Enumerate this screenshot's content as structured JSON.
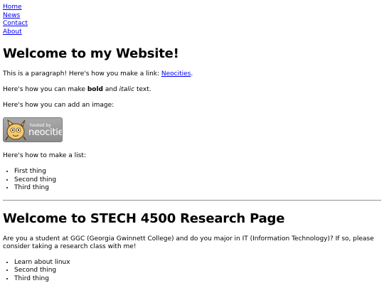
{
  "nav": {
    "items": [
      "Home",
      "News",
      "Contact",
      "About"
    ]
  },
  "section1": {
    "heading": "Welcome to my Website!",
    "para_link_prefix": "This is a paragraph! Here's how you make a link: ",
    "link_text": "Neocities",
    "para_link_suffix": ".",
    "bold_prefix": "Here's how you can make ",
    "bold_word": "bold",
    "bold_middle": " and ",
    "italic_word": "italic",
    "bold_suffix": " text.",
    "image_text": "Here's how you can add an image:",
    "badge_hosted": "hosted by",
    "badge_name": "neocities",
    "list_text": "Here's how to make a list:",
    "list": [
      "First thing",
      "Second thing",
      "Third thing"
    ]
  },
  "section2": {
    "heading": "Welcome to STECH 4500 Research Page",
    "intro": "Are you a student at GGC (Georgia Gwinnett College) and do you major in IT (Information Technology)? If so, please consider taking a research class with me!",
    "list": [
      "Learn about linux",
      "Second thing",
      "Third thing"
    ]
  },
  "colors": {
    "link": "#0000ee",
    "badge": "#9b9b9b"
  }
}
